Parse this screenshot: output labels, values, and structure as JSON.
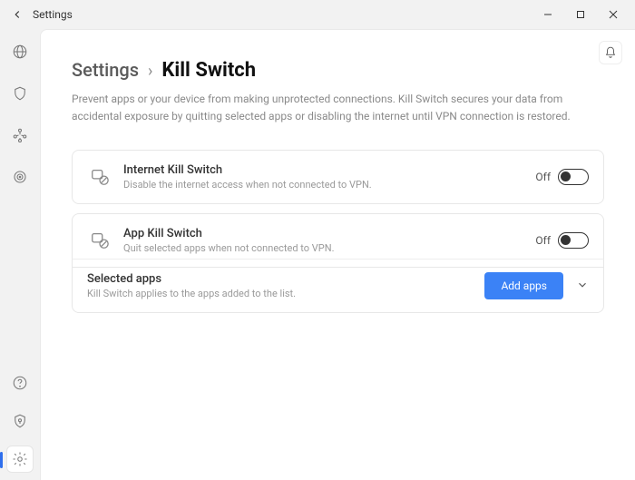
{
  "window": {
    "title": "Settings"
  },
  "breadcrumb": {
    "root": "Settings",
    "current": "Kill Switch"
  },
  "description": "Prevent apps or your device from making unprotected connections. Kill Switch secures your data from accidental exposure by quitting selected apps or disabling the internet until VPN connection is restored.",
  "cards": {
    "internet": {
      "title": "Internet Kill Switch",
      "subtitle": "Disable the internet access when not connected to VPN.",
      "state": "Off"
    },
    "app": {
      "title": "App Kill Switch",
      "subtitle": "Quit selected apps when not connected to VPN.",
      "state": "Off"
    }
  },
  "selected_apps": {
    "title": "Selected apps",
    "subtitle": "Kill Switch applies to the apps added to the list.",
    "button": "Add apps"
  }
}
